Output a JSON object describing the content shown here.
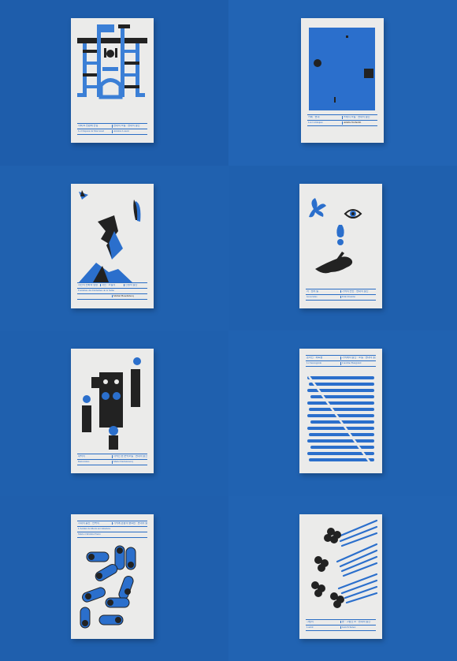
{
  "covers": [
    {
      "row1": [
        "사회 & 변환에 관심",
        "현대의 소설 · 현대의 출간"
      ],
      "row2": [
        "Le Chapeau de Morcessel",
        "Antoine Louzet"
      ]
    },
    {
      "row1": [
        "카페 · 현대",
        "프레지 소설 · 현대의 출간"
      ],
      "row2": [
        "Les Caldaques",
        "Amélie Nothomb"
      ]
    },
    {
      "row1": [
        "자연의 변화와 방향",
        "자연 · 소설의",
        "인생의 출간"
      ],
      "row2": [
        "Fontaines des Domaines de la Seine",
        "Michel Houellebecq"
      ]
    },
    {
      "row1": [
        "서 · 센서 발",
        "기억의 변신 · 현대의 출간"
      ],
      "row2": [
        "Grosciales",
        "Erik Orsenna"
      ]
    },
    {
      "row1": [
        "대략의",
        "사적인 한 문학소설 · 현대의 출간"
      ],
      "row2": [
        "Rencontres",
        "Marie Darrieussecq"
      ]
    },
    {
      "row1": [
        "온라인 · 외로움",
        "기억에서 출간 · 소설 · 현대의 출간"
      ],
      "row2": [
        "La Sauvegarde",
        "Caroline Bongrand"
      ]
    },
    {
      "row1": [
        "시대의 통신 · 반복의",
        "기억에 혼합의 중요한 · 현대의 출간"
      ],
      "row2": [
        "L'Arrière de Morts au Cimetière",
        "Marie-Christine Pierre"
      ]
    },
    {
      "row1": [
        "그림의",
        "문 · 그림인 소 · 현대의 출간"
      ],
      "row2": [
        "Loubir",
        "Jean Echenoz"
      ]
    }
  ]
}
